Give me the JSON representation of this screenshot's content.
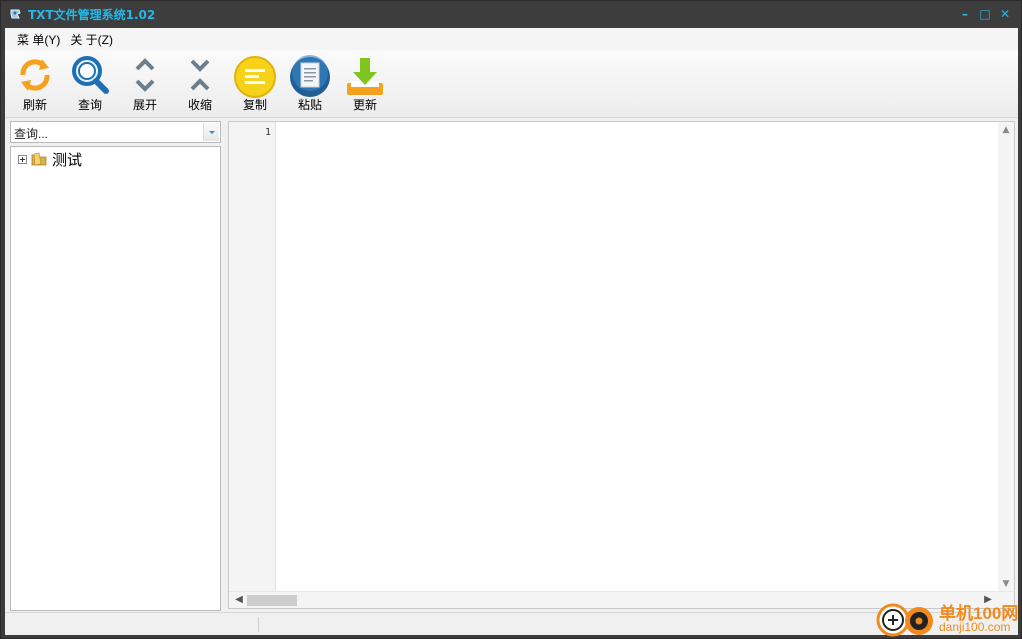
{
  "window": {
    "title": "TXT文件管理系统1.02",
    "minimize": "–",
    "maximize": "□",
    "close": "✕",
    "accent": "#27b6e6",
    "frame_color": "#3d3d3d"
  },
  "menu": {
    "items": [
      {
        "label": "菜 单(Y)"
      },
      {
        "label": "关 于(Z)"
      }
    ]
  },
  "toolbar": {
    "buttons": [
      {
        "label": "刷新",
        "icon": "refresh-icon"
      },
      {
        "label": "查询",
        "icon": "magnifier-icon"
      },
      {
        "label": "展开",
        "icon": "expand-chevrons-icon"
      },
      {
        "label": "收缩",
        "icon": "collapse-chevrons-icon"
      },
      {
        "label": "复制",
        "icon": "copy-list-icon"
      },
      {
        "label": "粘贴",
        "icon": "paste-document-icon"
      },
      {
        "label": "更新",
        "icon": "download-update-icon"
      }
    ]
  },
  "search": {
    "placeholder": "查询..."
  },
  "tree": {
    "nodes": [
      {
        "label": "测试",
        "icon": "folder-icon",
        "expanded": false
      }
    ]
  },
  "editor": {
    "line_numbers": [
      "1"
    ],
    "content": ""
  },
  "watermark": {
    "title": "单机100网",
    "url": "danji100.com"
  }
}
